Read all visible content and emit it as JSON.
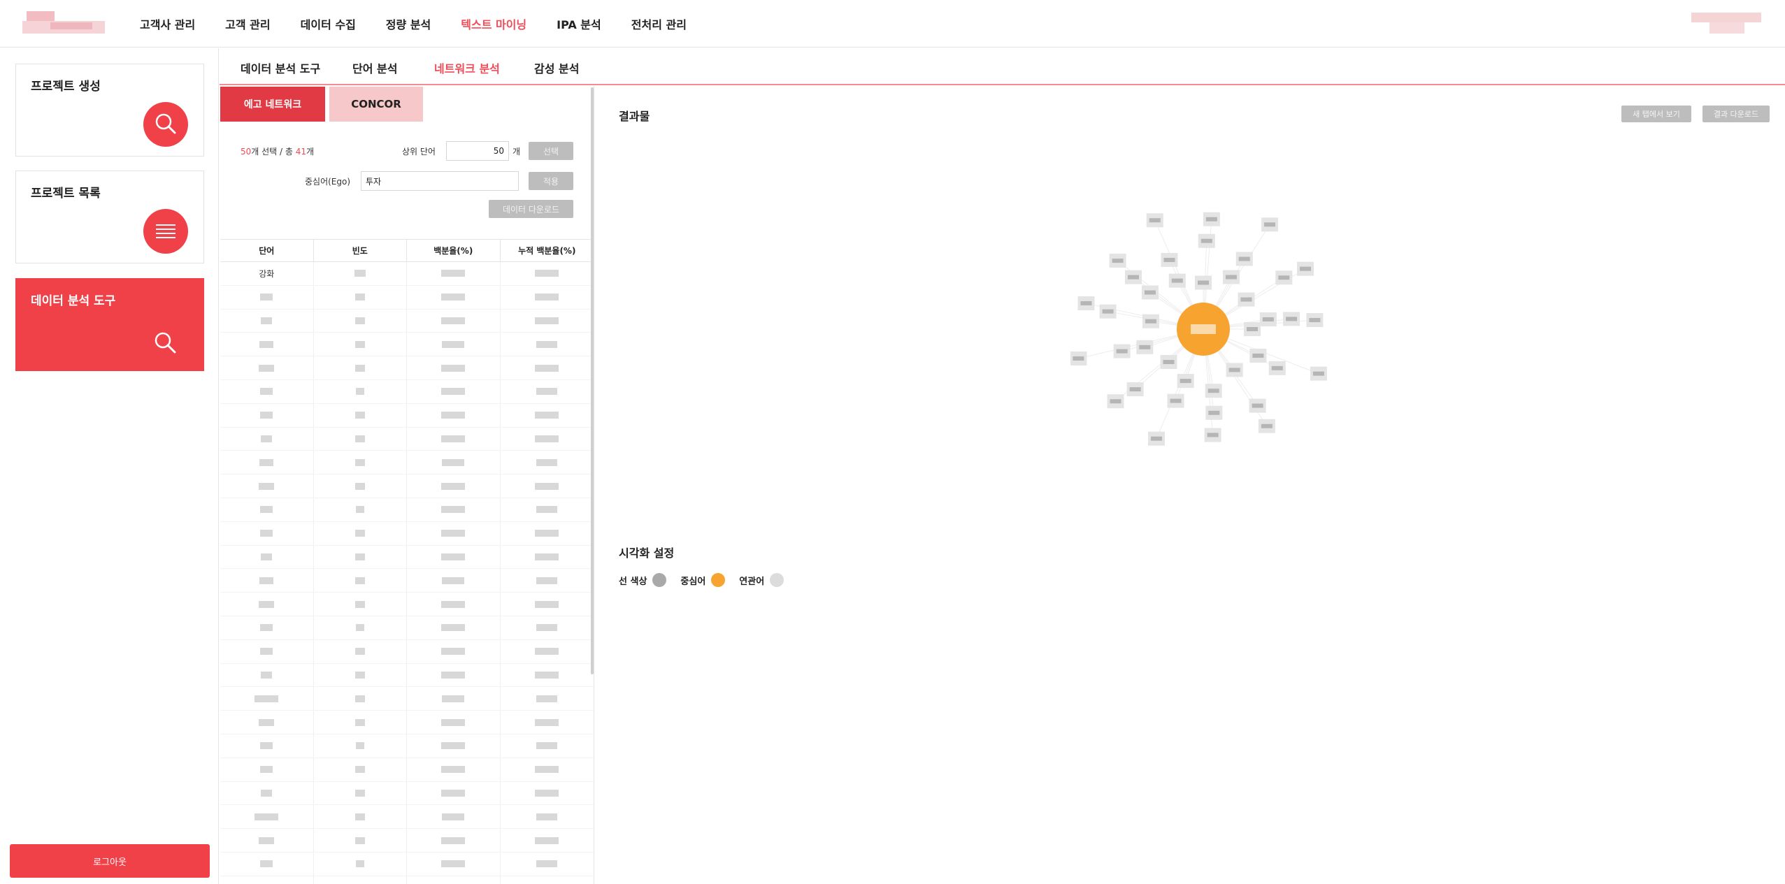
{
  "nav": {
    "items": [
      "고객사 관리",
      "고객 관리",
      "데이터 수집",
      "정량 분석",
      "텍스트 마이닝",
      "IPA 분석",
      "전처리 관리"
    ],
    "active_index": 4
  },
  "sidebar": {
    "cards": [
      {
        "title": "프로젝트 생성",
        "icon": "search-icon"
      },
      {
        "title": "프로젝트 목록",
        "icon": "list-icon"
      },
      {
        "title": "데이터 분석 도구",
        "icon": "search-icon"
      }
    ],
    "logout_label": "로그아웃"
  },
  "subtabs": {
    "items": [
      "데이터 분석 도구",
      "단어 분석",
      "네트워크 분석",
      "감성 분석"
    ],
    "active_index": 2
  },
  "left": {
    "seg_ego": "에고 네트워크",
    "seg_concor": "CONCOR",
    "selected_count": "50",
    "count_mid": "개 선택 / 총 ",
    "total_count": "41",
    "count_suffix": "개",
    "top_words_label": "상위 단어",
    "top_words_value": "50",
    "top_words_unit": "개",
    "select_button": "선택",
    "ego_label": "중심어(Ego)",
    "ego_value": "투자",
    "apply_button": "적용",
    "download_button": "데이터 다운로드",
    "table": {
      "headers": [
        "단어",
        "빈도",
        "백분율(%)",
        "누적 백분율(%)"
      ],
      "first_word": "강화"
    }
  },
  "right": {
    "result_title": "결과물",
    "new_tab_button": "새 탭에서 보기",
    "download_button": "결과 다운로드",
    "vis_title": "시각화 설정",
    "legend": [
      {
        "label": "선 색상",
        "color": "#a9a9a9"
      },
      {
        "label": "중심어",
        "color": "#f7a330"
      },
      {
        "label": "연관어",
        "color": "#dcdcdc"
      }
    ]
  },
  "colors": {
    "accent": "#f04148",
    "active_text": "#f14c57",
    "ego_node": "#f7a330"
  }
}
